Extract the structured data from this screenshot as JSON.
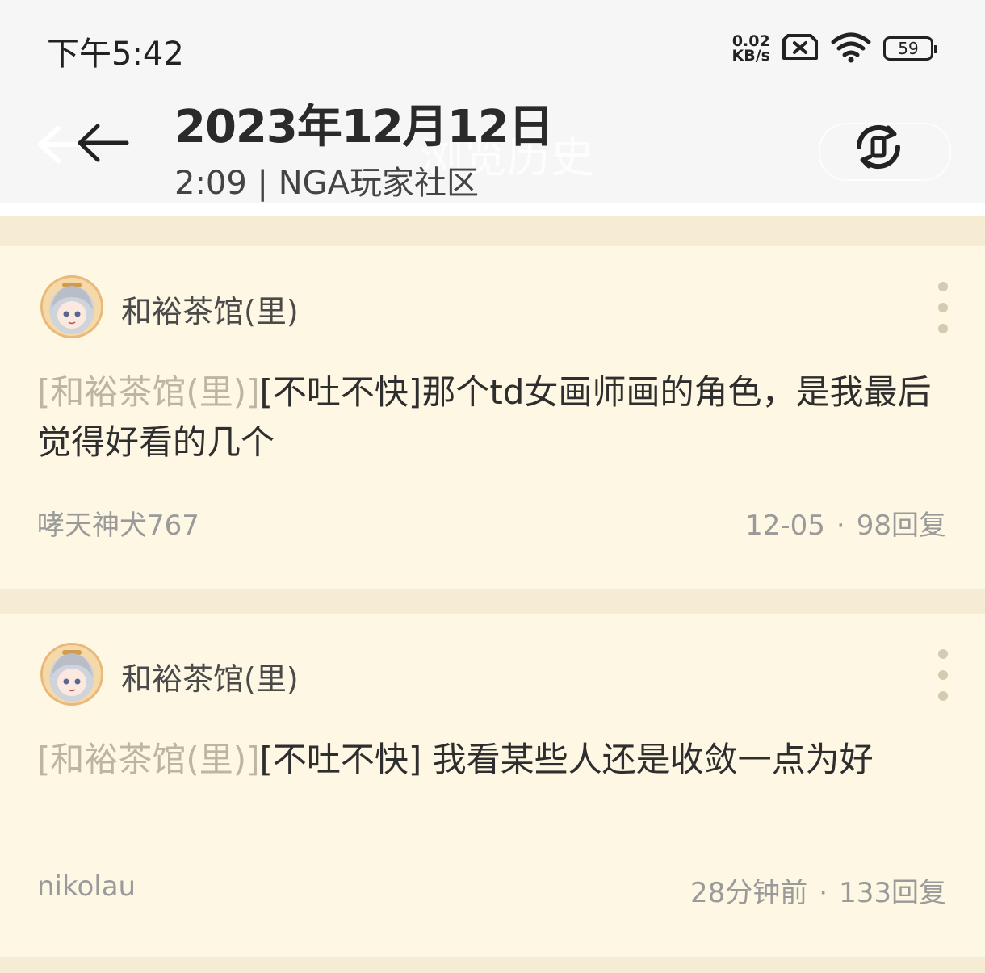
{
  "status_bar": {
    "time": "下午5:42",
    "net_speed_value": "0.02",
    "net_speed_unit": "KB/s",
    "battery": "59"
  },
  "header": {
    "ghost_title": "浏览历史",
    "date": "2023年12月12日",
    "subtitle": "2:09 | NGA玩家社区"
  },
  "posts": [
    {
      "forum": "和裕茶馆(里)",
      "tag": "[和裕茶馆(里)]",
      "title": "[不吐不快]那个td女画师画的角色，是我最后觉得好看的几个",
      "author": "哮天神犬767",
      "date": "12-05",
      "replies": "98回复"
    },
    {
      "forum": "和裕茶馆(里)",
      "tag": "[和裕茶馆(里)]",
      "title": "[不吐不快] 我看某些人还是收敛一点为好",
      "author": "nikolau",
      "date": "28分钟前",
      "replies": "133回复"
    }
  ],
  "colors": {
    "background": "#f5ecd3",
    "card": "#fdf7e3",
    "header": "#f6f6f6"
  }
}
